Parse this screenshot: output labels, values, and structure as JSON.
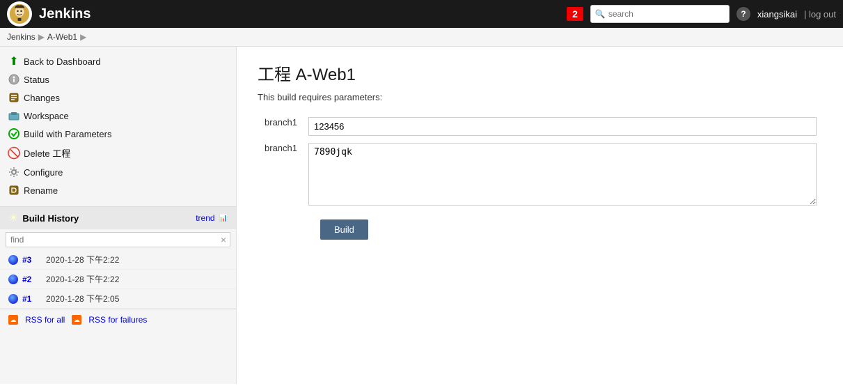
{
  "header": {
    "logo_text": "Jenkins",
    "notification_count": "2",
    "search_placeholder": "search",
    "help_label": "?",
    "username": "xiangsikai",
    "logout_label": "| log out"
  },
  "breadcrumb": {
    "items": [
      "Jenkins",
      "A-Web1",
      ""
    ]
  },
  "sidebar": {
    "items": [
      {
        "label": "Back to Dashboard",
        "icon": "back-icon"
      },
      {
        "label": "Status",
        "icon": "status-icon"
      },
      {
        "label": "Changes",
        "icon": "changes-icon"
      },
      {
        "label": "Workspace",
        "icon": "workspace-icon"
      },
      {
        "label": "Build with Parameters",
        "icon": "build-params-icon"
      },
      {
        "label": "Delete 工程",
        "icon": "delete-icon"
      },
      {
        "label": "Configure",
        "icon": "configure-icon"
      },
      {
        "label": "Rename",
        "icon": "rename-icon"
      }
    ],
    "build_history": {
      "title": "Build History",
      "trend_label": "trend",
      "find_placeholder": "find",
      "find_clear": "×",
      "items": [
        {
          "id": "#3",
          "time": "2020-1-28 下午2:22"
        },
        {
          "id": "#2",
          "time": "2020-1-28 下午2:22"
        },
        {
          "id": "#1",
          "time": "2020-1-28 下午2:05"
        }
      ],
      "rss_all_label": "RSS for all",
      "rss_failures_label": "RSS for failures"
    }
  },
  "content": {
    "title": "工程 A-Web1",
    "notice": "This build requires parameters:",
    "params": [
      {
        "label": "branch1",
        "type": "text",
        "value": "123456"
      },
      {
        "label": "branch1",
        "type": "textarea",
        "value": "7890jqk"
      }
    ],
    "build_button_label": "Build"
  }
}
